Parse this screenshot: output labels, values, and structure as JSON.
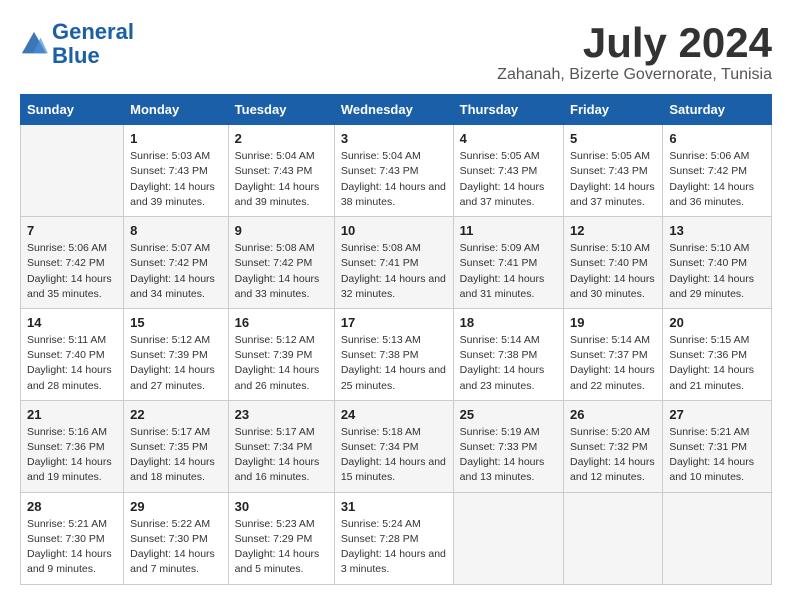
{
  "header": {
    "logo_line1": "General",
    "logo_line2": "Blue",
    "title": "July 2024",
    "subtitle": "Zahanah, Bizerte Governorate, Tunisia"
  },
  "columns": [
    "Sunday",
    "Monday",
    "Tuesday",
    "Wednesday",
    "Thursday",
    "Friday",
    "Saturday"
  ],
  "weeks": [
    [
      {
        "day": "",
        "sunrise": "",
        "sunset": "",
        "daylight": ""
      },
      {
        "day": "1",
        "sunrise": "Sunrise: 5:03 AM",
        "sunset": "Sunset: 7:43 PM",
        "daylight": "Daylight: 14 hours and 39 minutes."
      },
      {
        "day": "2",
        "sunrise": "Sunrise: 5:04 AM",
        "sunset": "Sunset: 7:43 PM",
        "daylight": "Daylight: 14 hours and 39 minutes."
      },
      {
        "day": "3",
        "sunrise": "Sunrise: 5:04 AM",
        "sunset": "Sunset: 7:43 PM",
        "daylight": "Daylight: 14 hours and 38 minutes."
      },
      {
        "day": "4",
        "sunrise": "Sunrise: 5:05 AM",
        "sunset": "Sunset: 7:43 PM",
        "daylight": "Daylight: 14 hours and 37 minutes."
      },
      {
        "day": "5",
        "sunrise": "Sunrise: 5:05 AM",
        "sunset": "Sunset: 7:43 PM",
        "daylight": "Daylight: 14 hours and 37 minutes."
      },
      {
        "day": "6",
        "sunrise": "Sunrise: 5:06 AM",
        "sunset": "Sunset: 7:42 PM",
        "daylight": "Daylight: 14 hours and 36 minutes."
      }
    ],
    [
      {
        "day": "7",
        "sunrise": "Sunrise: 5:06 AM",
        "sunset": "Sunset: 7:42 PM",
        "daylight": "Daylight: 14 hours and 35 minutes."
      },
      {
        "day": "8",
        "sunrise": "Sunrise: 5:07 AM",
        "sunset": "Sunset: 7:42 PM",
        "daylight": "Daylight: 14 hours and 34 minutes."
      },
      {
        "day": "9",
        "sunrise": "Sunrise: 5:08 AM",
        "sunset": "Sunset: 7:42 PM",
        "daylight": "Daylight: 14 hours and 33 minutes."
      },
      {
        "day": "10",
        "sunrise": "Sunrise: 5:08 AM",
        "sunset": "Sunset: 7:41 PM",
        "daylight": "Daylight: 14 hours and 32 minutes."
      },
      {
        "day": "11",
        "sunrise": "Sunrise: 5:09 AM",
        "sunset": "Sunset: 7:41 PM",
        "daylight": "Daylight: 14 hours and 31 minutes."
      },
      {
        "day": "12",
        "sunrise": "Sunrise: 5:10 AM",
        "sunset": "Sunset: 7:40 PM",
        "daylight": "Daylight: 14 hours and 30 minutes."
      },
      {
        "day": "13",
        "sunrise": "Sunrise: 5:10 AM",
        "sunset": "Sunset: 7:40 PM",
        "daylight": "Daylight: 14 hours and 29 minutes."
      }
    ],
    [
      {
        "day": "14",
        "sunrise": "Sunrise: 5:11 AM",
        "sunset": "Sunset: 7:40 PM",
        "daylight": "Daylight: 14 hours and 28 minutes."
      },
      {
        "day": "15",
        "sunrise": "Sunrise: 5:12 AM",
        "sunset": "Sunset: 7:39 PM",
        "daylight": "Daylight: 14 hours and 27 minutes."
      },
      {
        "day": "16",
        "sunrise": "Sunrise: 5:12 AM",
        "sunset": "Sunset: 7:39 PM",
        "daylight": "Daylight: 14 hours and 26 minutes."
      },
      {
        "day": "17",
        "sunrise": "Sunrise: 5:13 AM",
        "sunset": "Sunset: 7:38 PM",
        "daylight": "Daylight: 14 hours and 25 minutes."
      },
      {
        "day": "18",
        "sunrise": "Sunrise: 5:14 AM",
        "sunset": "Sunset: 7:38 PM",
        "daylight": "Daylight: 14 hours and 23 minutes."
      },
      {
        "day": "19",
        "sunrise": "Sunrise: 5:14 AM",
        "sunset": "Sunset: 7:37 PM",
        "daylight": "Daylight: 14 hours and 22 minutes."
      },
      {
        "day": "20",
        "sunrise": "Sunrise: 5:15 AM",
        "sunset": "Sunset: 7:36 PM",
        "daylight": "Daylight: 14 hours and 21 minutes."
      }
    ],
    [
      {
        "day": "21",
        "sunrise": "Sunrise: 5:16 AM",
        "sunset": "Sunset: 7:36 PM",
        "daylight": "Daylight: 14 hours and 19 minutes."
      },
      {
        "day": "22",
        "sunrise": "Sunrise: 5:17 AM",
        "sunset": "Sunset: 7:35 PM",
        "daylight": "Daylight: 14 hours and 18 minutes."
      },
      {
        "day": "23",
        "sunrise": "Sunrise: 5:17 AM",
        "sunset": "Sunset: 7:34 PM",
        "daylight": "Daylight: 14 hours and 16 minutes."
      },
      {
        "day": "24",
        "sunrise": "Sunrise: 5:18 AM",
        "sunset": "Sunset: 7:34 PM",
        "daylight": "Daylight: 14 hours and 15 minutes."
      },
      {
        "day": "25",
        "sunrise": "Sunrise: 5:19 AM",
        "sunset": "Sunset: 7:33 PM",
        "daylight": "Daylight: 14 hours and 13 minutes."
      },
      {
        "day": "26",
        "sunrise": "Sunrise: 5:20 AM",
        "sunset": "Sunset: 7:32 PM",
        "daylight": "Daylight: 14 hours and 12 minutes."
      },
      {
        "day": "27",
        "sunrise": "Sunrise: 5:21 AM",
        "sunset": "Sunset: 7:31 PM",
        "daylight": "Daylight: 14 hours and 10 minutes."
      }
    ],
    [
      {
        "day": "28",
        "sunrise": "Sunrise: 5:21 AM",
        "sunset": "Sunset: 7:30 PM",
        "daylight": "Daylight: 14 hours and 9 minutes."
      },
      {
        "day": "29",
        "sunrise": "Sunrise: 5:22 AM",
        "sunset": "Sunset: 7:30 PM",
        "daylight": "Daylight: 14 hours and 7 minutes."
      },
      {
        "day": "30",
        "sunrise": "Sunrise: 5:23 AM",
        "sunset": "Sunset: 7:29 PM",
        "daylight": "Daylight: 14 hours and 5 minutes."
      },
      {
        "day": "31",
        "sunrise": "Sunrise: 5:24 AM",
        "sunset": "Sunset: 7:28 PM",
        "daylight": "Daylight: 14 hours and 3 minutes."
      },
      {
        "day": "",
        "sunrise": "",
        "sunset": "",
        "daylight": ""
      },
      {
        "day": "",
        "sunrise": "",
        "sunset": "",
        "daylight": ""
      },
      {
        "day": "",
        "sunrise": "",
        "sunset": "",
        "daylight": ""
      }
    ]
  ]
}
